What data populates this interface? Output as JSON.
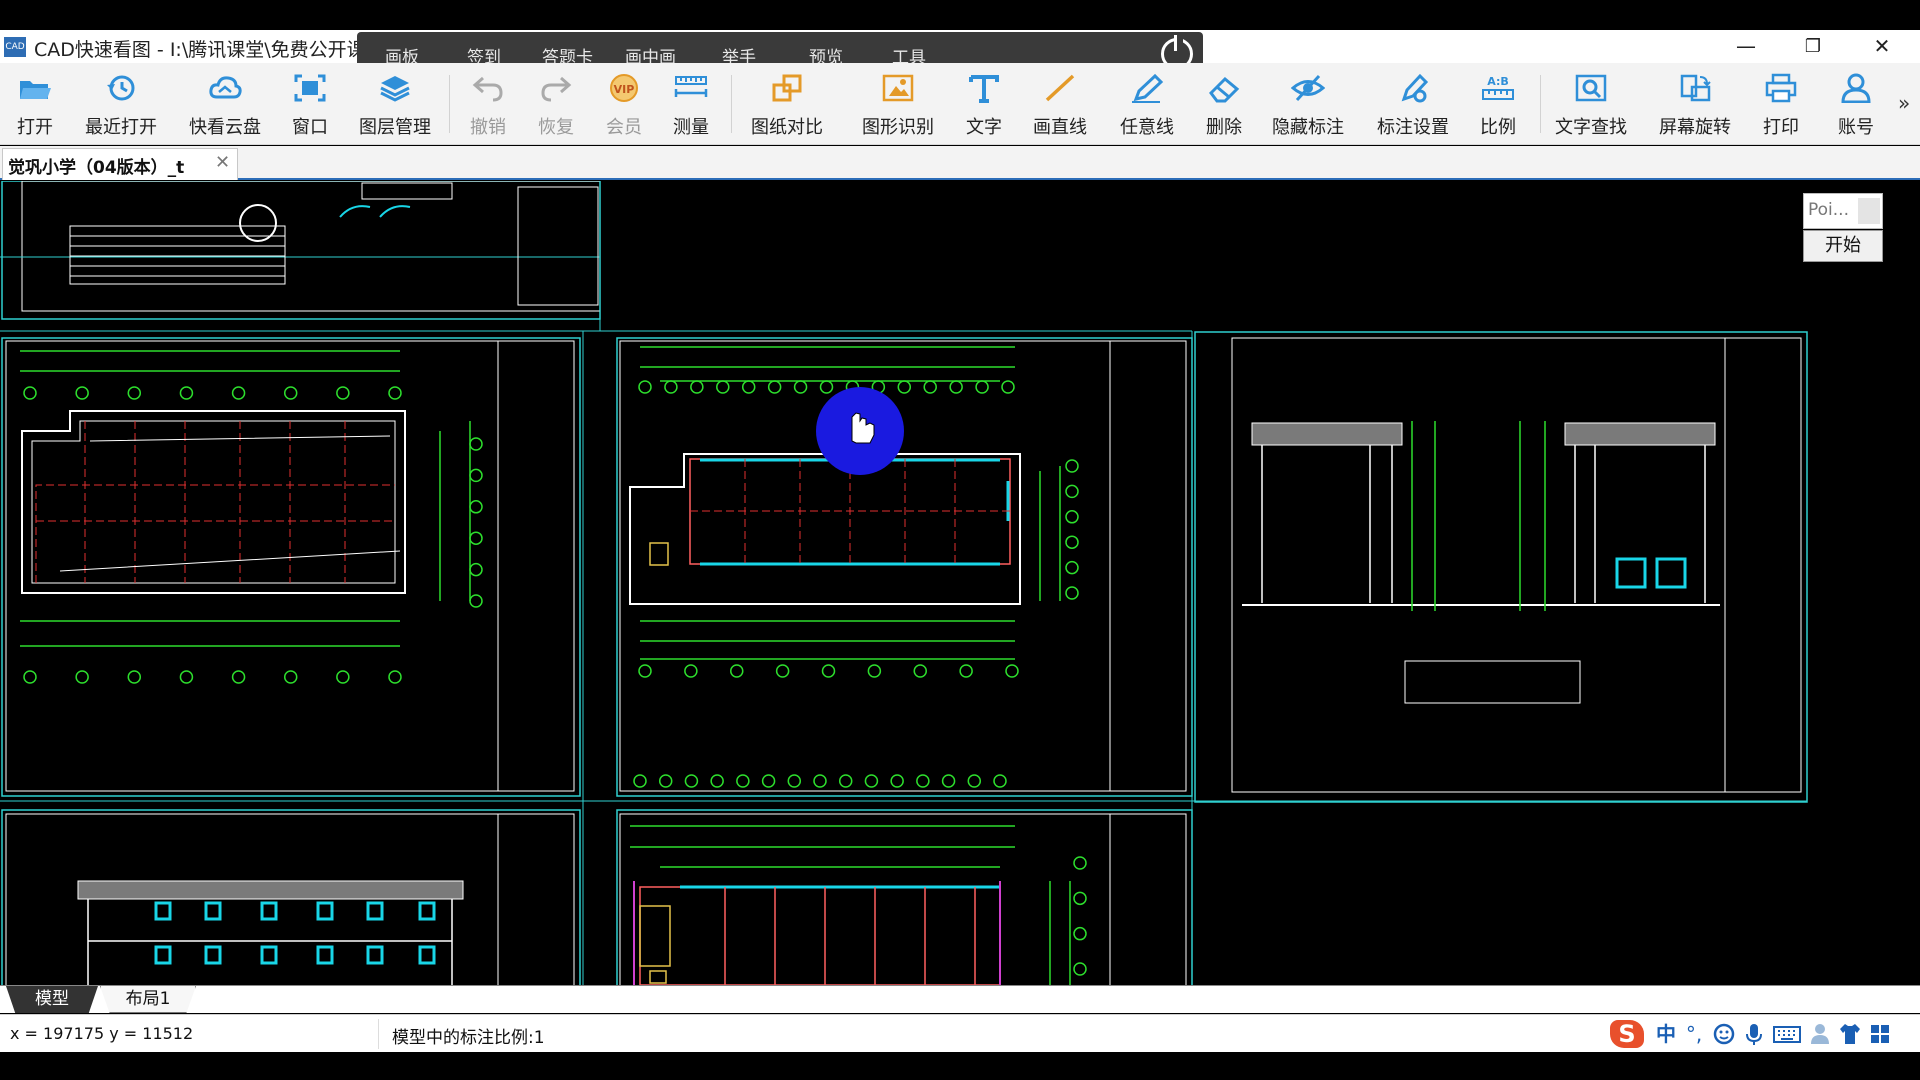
{
  "window": {
    "title": "CAD快速看图 - I:\\腾讯课堂\\免费公开课\\",
    "icon_text": "CAD",
    "minimize_glyph": "—",
    "restore_glyph": "❐",
    "close_glyph": "✕"
  },
  "float_bar": {
    "items": [
      "画板",
      "签到",
      "答题卡",
      "画中画",
      "举手",
      "预览",
      "工具"
    ]
  },
  "toolbar": {
    "items": [
      {
        "label": "打开",
        "icon": "folder-open-icon",
        "enabled": true
      },
      {
        "label": "最近打开",
        "icon": "clock-history-icon",
        "enabled": true
      },
      {
        "label": "快看云盘",
        "icon": "cloud-icon",
        "enabled": true
      },
      {
        "label": "窗口",
        "icon": "window-fit-icon",
        "enabled": true
      },
      {
        "label": "图层管理",
        "icon": "layers-icon",
        "enabled": true
      },
      {
        "label": "撤销",
        "icon": "undo-icon",
        "enabled": false
      },
      {
        "label": "恢复",
        "icon": "redo-icon",
        "enabled": false
      },
      {
        "label": "会员",
        "icon": "vip-icon",
        "enabled": false
      },
      {
        "label": "测量",
        "icon": "ruler-icon",
        "enabled": true
      },
      {
        "label": "图纸对比",
        "icon": "compare-icon",
        "enabled": true
      },
      {
        "label": "图形识别",
        "icon": "shape-recognize-icon",
        "enabled": true
      },
      {
        "label": "文字",
        "icon": "text-icon",
        "enabled": true
      },
      {
        "label": "画直线",
        "icon": "line-icon",
        "enabled": true
      },
      {
        "label": "任意线",
        "icon": "pen-icon",
        "enabled": true
      },
      {
        "label": "删除",
        "icon": "eraser-icon",
        "enabled": true
      },
      {
        "label": "隐藏标注",
        "icon": "eye-hidden-icon",
        "enabled": true
      },
      {
        "label": "标注设置",
        "icon": "annotation-settings-icon",
        "enabled": true
      },
      {
        "label": "比例",
        "icon": "scale-icon",
        "enabled": true
      },
      {
        "label": "文字查找",
        "icon": "text-search-icon",
        "enabled": true
      },
      {
        "label": "屏幕旋转",
        "icon": "rotate-screen-icon",
        "enabled": true
      },
      {
        "label": "打印",
        "icon": "printer-icon",
        "enabled": true
      },
      {
        "label": "账号",
        "icon": "user-icon",
        "enabled": true
      }
    ],
    "more_glyph": "»"
  },
  "document_tab": {
    "label": "觉巩小学（04版本）_t",
    "close_glyph": "✕"
  },
  "point_search": {
    "placeholder": "Poi...",
    "start_label": "开始"
  },
  "layout_tabs": [
    "模型",
    "布局1"
  ],
  "status": {
    "coords": "x = 197175  y = 11512",
    "scale": "模型中的标注比例:1"
  },
  "ime": {
    "logo": "S",
    "lang": "中",
    "punct": "°,",
    "icons": [
      "emoji-icon",
      "microphone-icon",
      "keyboard-icon",
      "user-tray-icon",
      "shirt-icon",
      "grid-menu-icon"
    ]
  },
  "colors": {
    "canvas_bg": "#000000",
    "frame_cyan": "#2fd0d0",
    "grid_green": "#2dde2d",
    "axis_red": "#e03030",
    "wall_white": "#ffffff",
    "window_cyan": "#19d6e8",
    "cursor_highlight": "#1a1ae0",
    "toolbar_icon_blue": "#2f8fd8",
    "toolbar_icon_orange": "#e49a28"
  }
}
